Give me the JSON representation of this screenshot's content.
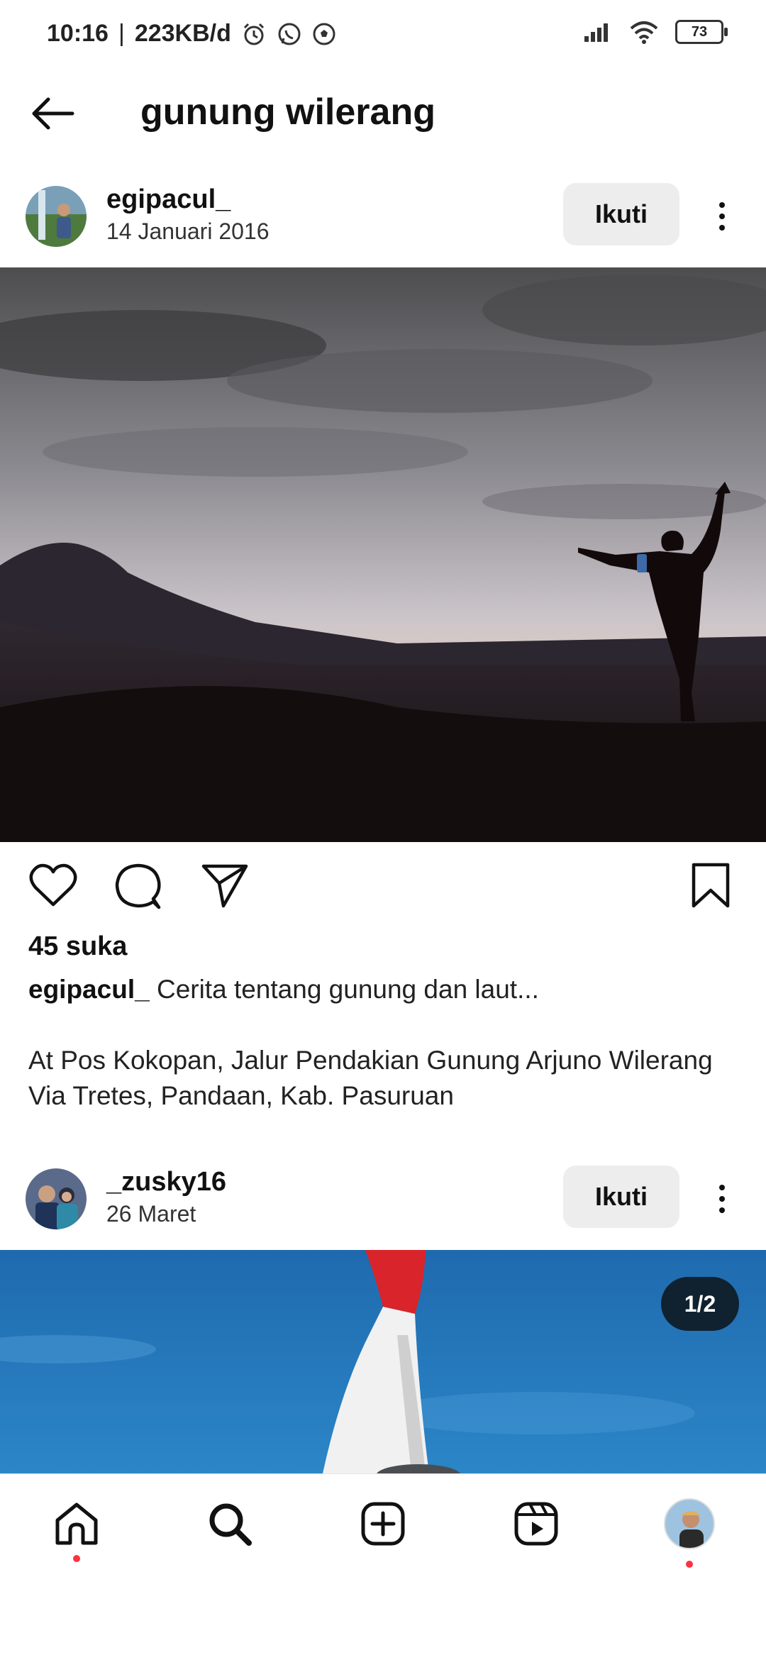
{
  "status_bar": {
    "time": "10:16",
    "separator": "|",
    "data_rate": "223KB/d",
    "icons": [
      "alarm-icon",
      "whatsapp-icon",
      "soccer-ball-icon",
      "signal-icon",
      "wifi-icon",
      "battery-icon"
    ],
    "battery": "73"
  },
  "header": {
    "title": "gunung wilerang",
    "back_icon": "arrow-left-icon"
  },
  "posts": [
    {
      "username": "egipacul_",
      "date": "14 Januari 2016",
      "follow_label": "Ikuti",
      "likes": "45 suka",
      "caption_user": "egipacul_",
      "caption_text": "Cerita tentang gunung dan laut...",
      "caption_body": "At Pos Kokopan, Jalur Pendakian Gunung Arjuno Wilerang Via Tretes, Pandaan, Kab. Pasuruan"
    },
    {
      "username": "_zusky16",
      "date": "26 Maret",
      "follow_label": "Ikuti",
      "image_counter": "1/2"
    }
  ],
  "actions": [
    "heart-icon",
    "comment-icon",
    "share-icon",
    "bookmark-icon"
  ],
  "bottom_nav": [
    "home-icon",
    "search-icon",
    "create-icon",
    "reels-icon",
    "profile-avatar"
  ],
  "colors": {
    "follow_bg": "#ededed",
    "notification_dot": "#ff3040",
    "counter_bg": "#10222f"
  }
}
